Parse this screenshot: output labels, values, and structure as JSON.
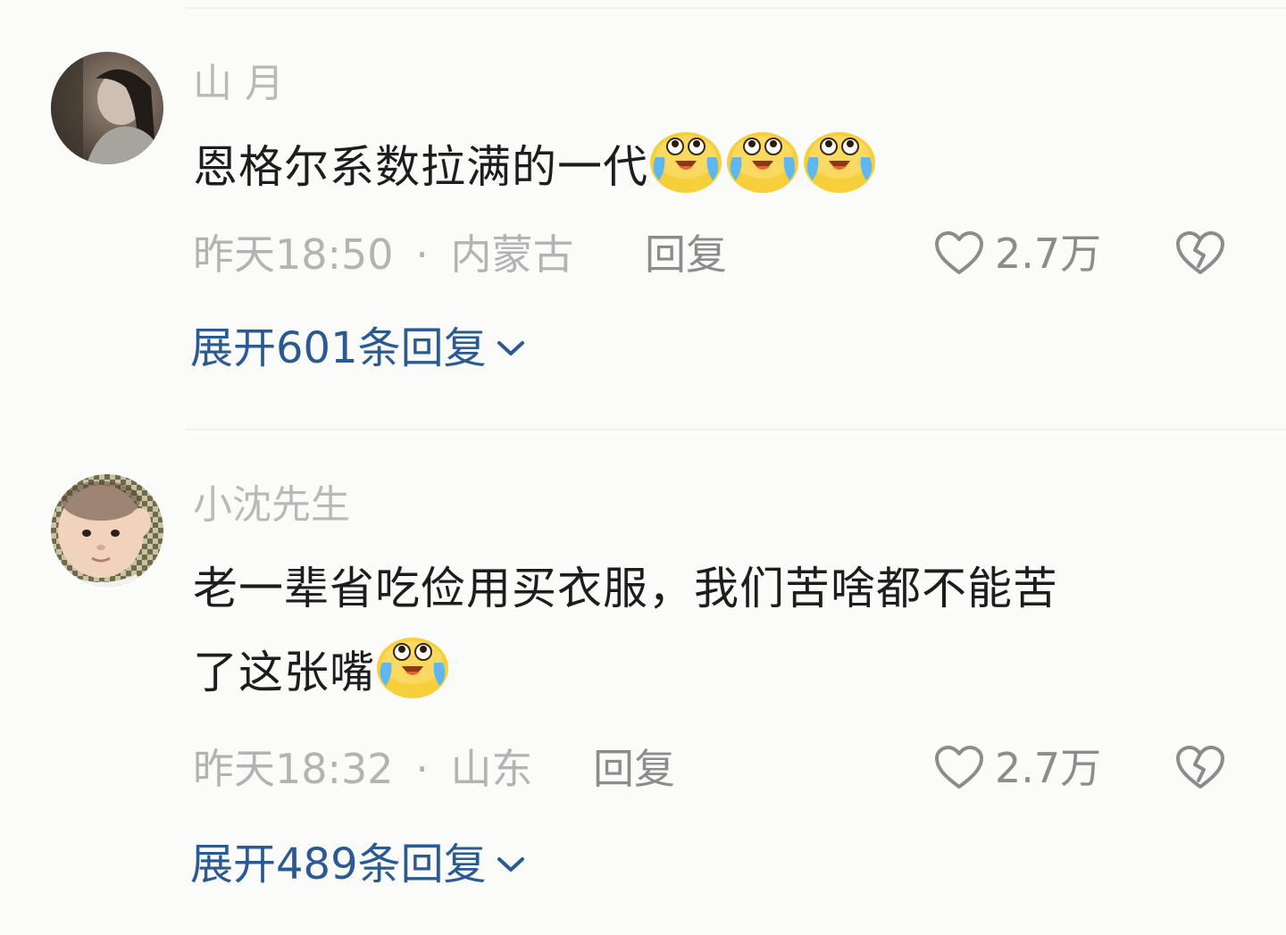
{
  "comments": [
    {
      "username": "山 月",
      "content": "恩格尔系数拉满的一代",
      "emoji_count": 3,
      "emoji": "crying-laughing-emoji",
      "time": "昨天18:50",
      "separator": "·",
      "location": "内蒙古",
      "reply_label": "回复",
      "likes": "2.7万",
      "expand_label": "展开601条回复"
    },
    {
      "username": "小沈先生",
      "content_line1": "老一辈省吃俭用买衣服，我们苦啥都不能苦",
      "content_line2": "了这张嘴",
      "emoji_count": 1,
      "emoji": "crying-laughing-emoji",
      "time": "昨天18:32",
      "separator": "·",
      "location": "山东",
      "reply_label": "回复",
      "likes": "2.7万",
      "expand_label": "展开489条回复"
    }
  ],
  "colors": {
    "background": "#fbfbfa",
    "username": "#b9b9b9",
    "content": "#1d1d1d",
    "meta": "#b3b3b3",
    "action": "#8c8c8c",
    "link": "#2a5a93"
  },
  "icons": {
    "like": "heart-outline-icon",
    "dislike": "broken-heart-icon",
    "expand": "chevron-down-icon"
  }
}
